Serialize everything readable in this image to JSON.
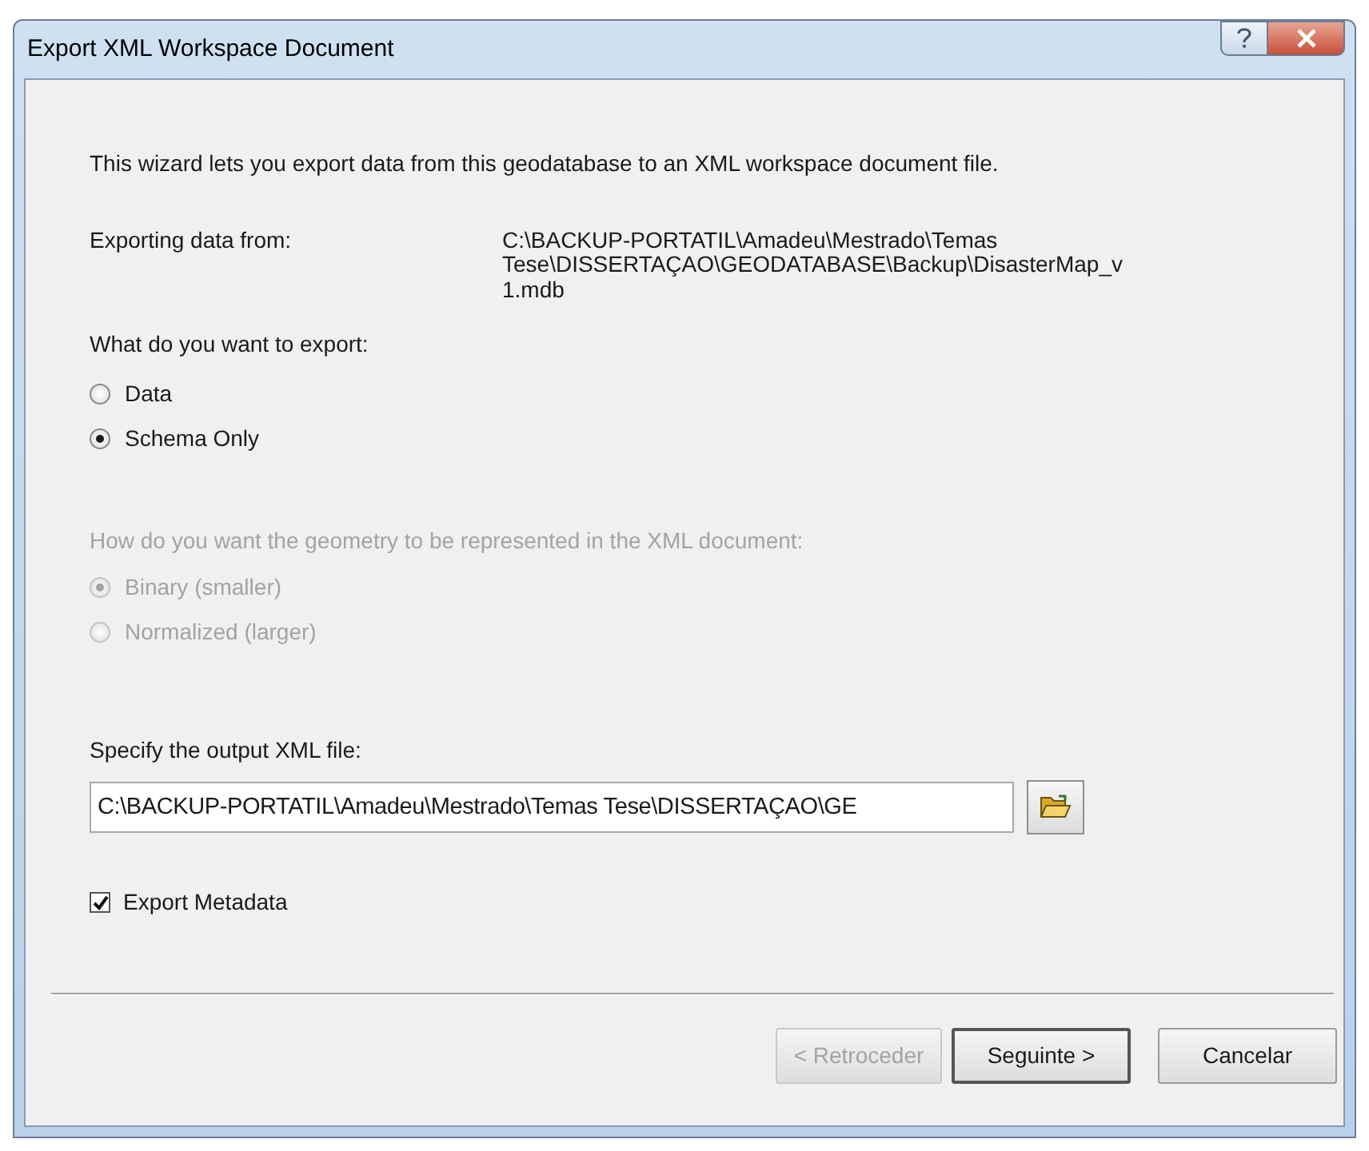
{
  "window": {
    "title": "Export XML Workspace Document"
  },
  "intro": "This wizard lets you export data from this geodatabase to an XML workspace document file.",
  "source": {
    "label": "Exporting data from:",
    "value_lines": [
      "C:\\BACKUP-PORTATIL\\Amadeu\\Mestrado\\Temas",
      "Tese\\DISSERTAÇAO\\GEODATABASE\\Backup\\DisasterMap_v",
      "1.mdb"
    ]
  },
  "export_question": "What do you want to export:",
  "export_options": [
    {
      "label": "Data",
      "selected": false
    },
    {
      "label": "Schema Only",
      "selected": true
    }
  ],
  "geometry": {
    "label": "How do you want the geometry to be represented in the XML document:",
    "disabled": true,
    "options": [
      {
        "label": "Binary (smaller)",
        "selected": true
      },
      {
        "label": "Normalized (larger)",
        "selected": false
      }
    ]
  },
  "output": {
    "label": "Specify the output XML file:",
    "value": "C:\\BACKUP-PORTATIL\\Amadeu\\Mestrado\\Temas Tese\\DISSERTAÇAO\\GE"
  },
  "export_metadata": {
    "label": "Export Metadata",
    "checked": true
  },
  "buttons": [
    {
      "label": "< Retroceder",
      "disabled": true,
      "default": false
    },
    {
      "label": "Seguinte >",
      "disabled": false,
      "default": true
    },
    {
      "label": "Cancelar",
      "disabled": false,
      "default": false
    }
  ]
}
